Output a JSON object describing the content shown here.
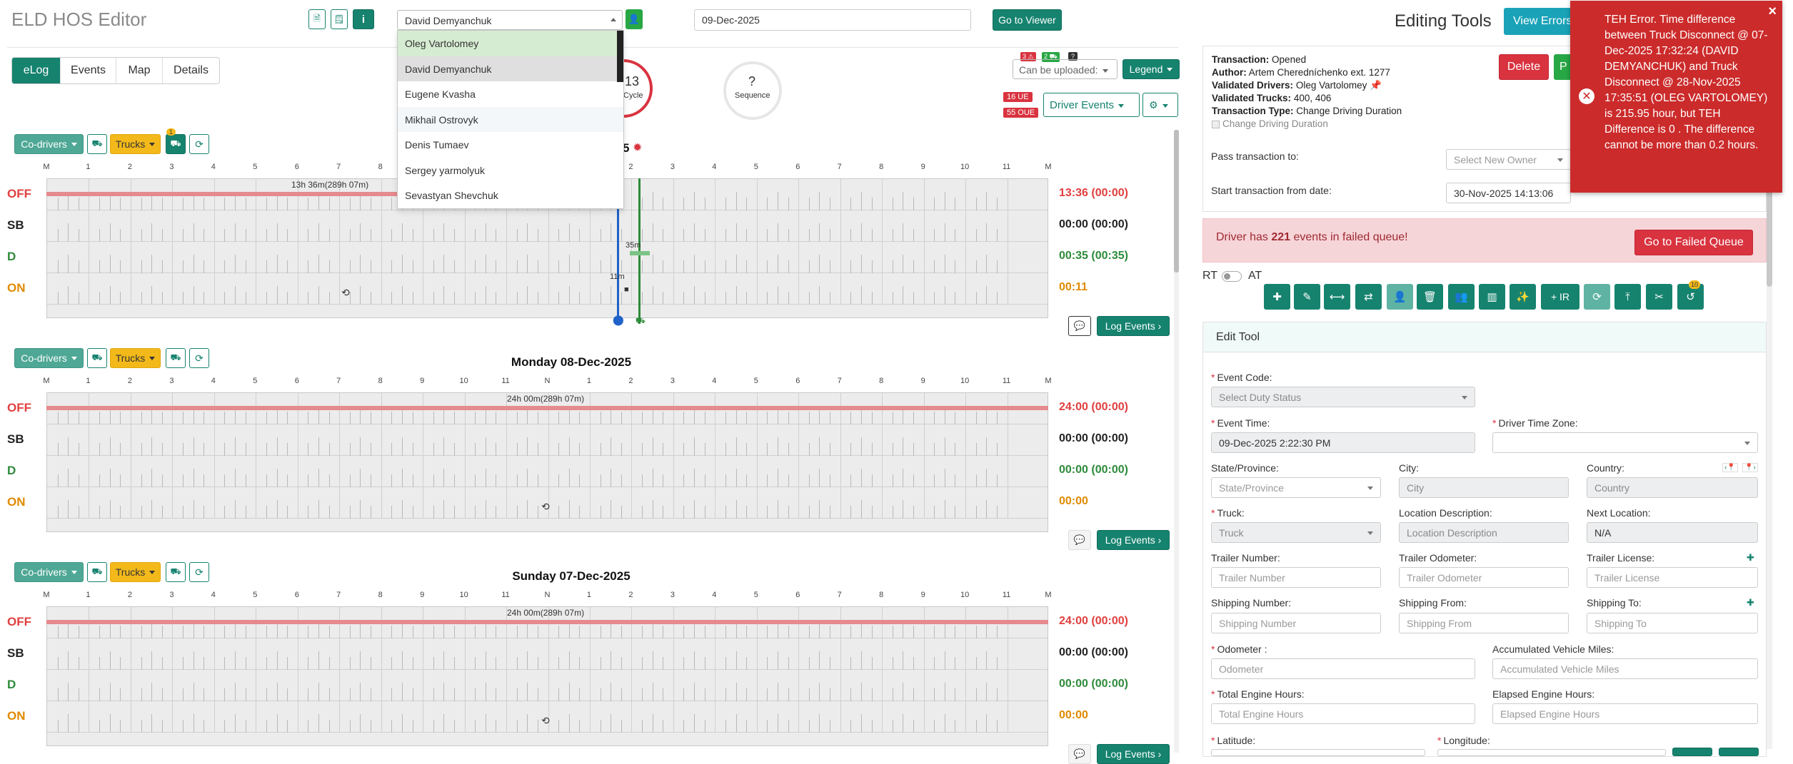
{
  "app": {
    "title": "ELD HOS Editor"
  },
  "header": {
    "driver_selected": "David Demyanchuk",
    "date": "09-Dec-2025",
    "go_viewer": "Go to Viewer",
    "driver_options": [
      "Oleg Vartolomey",
      "David Demyanchuk",
      "Eugene Kvasha",
      "Mikhail Ostrovyk",
      "Denis Tumaev",
      "Sergey yarmolyuk",
      "Sevastyan Shevchuk"
    ]
  },
  "tabs": [
    "eLog",
    "Events",
    "Map",
    "Details"
  ],
  "circles": {
    "cycle_value": "13",
    "cycle_label": "Cycle",
    "seq_value": "?",
    "seq_label": "Sequence"
  },
  "badges": {
    "b1": "3 ⚠",
    "b2": "2 ⛟",
    "b3": "?",
    "ue": "16 UE",
    "oue": "55 OUE"
  },
  "controls": {
    "upload": "Can be uploaded:",
    "legend": "Legend",
    "driver_events": "Driver Events"
  },
  "log_toolbar": {
    "codrivers": "Co-drivers",
    "trucks": "Trucks",
    "notif": "1"
  },
  "hours": [
    "M",
    "1",
    "2",
    "3",
    "4",
    "5",
    "6",
    "7",
    "8",
    "9",
    "10",
    "11",
    "N",
    "1",
    "2",
    "3",
    "4",
    "5",
    "6",
    "7",
    "8",
    "9",
    "10",
    "11",
    "M"
  ],
  "row_labels": [
    "OFF",
    "SB",
    "D",
    "ON"
  ],
  "days": [
    {
      "title": "",
      "title_suffix": "5",
      "off_bar_label": "13h 36m(289h 07m)",
      "totals": [
        "13:36 (00:00)",
        "00:00 (00:00)",
        "00:35 (00:35)",
        "00:11"
      ],
      "d_label": "35m",
      "on_label": "11m",
      "log_events": "Log Events"
    },
    {
      "title": "Monday 08-Dec-2025",
      "off_bar_label": "24h 00m(289h 07m)",
      "totals": [
        "24:00 (00:00)",
        "00:00 (00:00)",
        "00:00 (00:00)",
        "00:00"
      ],
      "log_events": "Log Events"
    },
    {
      "title": "Sunday 07-Dec-2025",
      "off_bar_label": "24h 00m(289h 07m)",
      "totals": [
        "24:00 (00:00)",
        "00:00 (00:00)",
        "00:00 (00:00)",
        "00:00"
      ],
      "log_events": "Log Events"
    }
  ],
  "right": {
    "title": "Editing Tools",
    "view_errors": "View Errors",
    "delete": "Delete",
    "publish": "P",
    "transaction": {
      "k1": "Transaction:",
      "v1": "Opened",
      "k2": "Author:",
      "v2": "Artem Cheredníchenko ext. 1277",
      "k3": "Validated Drivers:",
      "v3": "Oleg Vartolomey",
      "k4": "Validated Trucks:",
      "v4": "400, 406",
      "k5": "Transaction Type:",
      "v5": "Change Driving Duration",
      "check": "Change Driving Duration"
    },
    "pass_to_label": "Pass transaction to:",
    "pass_to_ph": "Select New Owner",
    "start_from_label": "Start transaction from date:",
    "start_from_value": "30-Nov-2025 14:13:06",
    "failed_pre": "Driver has ",
    "failed_count": "221",
    "failed_post": " events in failed queue!",
    "go_failed": "Go to Failed Queue",
    "rt": "RT",
    "at": "AT",
    "tool_badge": "10",
    "ir": "+ IR",
    "edit_tool": "Edit Tool",
    "form": {
      "event_code": "Event Code:",
      "event_code_ph": "Select Duty Status",
      "event_time": "Event Time:",
      "event_time_val": "09-Dec-2025 2:22:30 PM",
      "tz": "Driver Time Zone:",
      "state": "State/Province:",
      "state_ph": "State/Province",
      "city": "City:",
      "city_ph": "City",
      "country": "Country:",
      "country_ph": "Country",
      "truck": "Truck:",
      "truck_ph": "Truck",
      "loc_desc": "Location Description:",
      "loc_desc_ph": "Location Description",
      "next_loc": "Next Location:",
      "next_loc_val": "N/A",
      "trailer_num": "Trailer Number:",
      "trailer_num_ph": "Trailer Number",
      "trailer_odo": "Trailer Odometer:",
      "trailer_odo_ph": "Trailer Odometer",
      "trailer_lic": "Trailer License:",
      "trailer_lic_ph": "Trailer License",
      "ship_num": "Shipping Number:",
      "ship_num_ph": "Shipping Number",
      "ship_from": "Shipping From:",
      "ship_from_ph": "Shipping From",
      "ship_to": "Shipping To:",
      "ship_to_ph": "Shipping To",
      "odometer": "Odometer :",
      "odometer_ph": "Odometer",
      "acc_miles": "Accumulated Vehicle Miles:",
      "acc_miles_ph": "Accumulated Vehicle Miles",
      "eng_hours": "Total Engine Hours:",
      "eng_hours_ph": "Total Engine Hours",
      "elapsed": "Elapsed Engine Hours:",
      "elapsed_ph": "Elapsed Engine Hours",
      "lat": "Latitude:",
      "lon": "Longitude:"
    }
  },
  "toast": {
    "message": "TEH Error. Time difference between Truck Disconnect @ 07-Dec-2025 17:32:24 (DAVID DEMYANCHUK) and Truck Disconnect @ 28-Nov-2025 17:35:51 (OLEG VARTOLOMEY) is 215.95 hour, but TEH Difference is 0 . The difference cannot be more than 0.2 hours.",
    "close": "×"
  },
  "colors": {
    "teal": "#16836f",
    "red": "#d9333f",
    "yellow": "#f3b91a",
    "toast": "#cc2b2b"
  }
}
